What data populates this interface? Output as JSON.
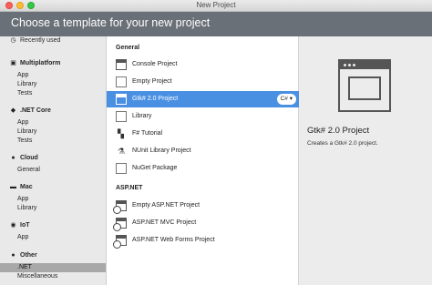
{
  "window": {
    "title": "New Project"
  },
  "header": {
    "title": "Choose a template for your new project"
  },
  "sidebar": {
    "recently_used": {
      "icon": "clock-icon",
      "label": "Recently used"
    },
    "categories": [
      {
        "name": "Multiplatform",
        "icon": "multiplatform-icon",
        "items": [
          "App",
          "Library",
          "Tests"
        ]
      },
      {
        "name": ".NET Core",
        "icon": "dotnet-core-icon",
        "items": [
          "App",
          "Library",
          "Tests"
        ]
      },
      {
        "name": "Cloud",
        "icon": "cloud-icon",
        "items": [
          "General"
        ]
      },
      {
        "name": "Mac",
        "icon": "mac-icon",
        "items": [
          "App",
          "Library"
        ]
      },
      {
        "name": "IoT",
        "icon": "iot-icon",
        "items": [
          "App"
        ]
      },
      {
        "name": "Other",
        "icon": "other-icon",
        "items": [
          ".NET",
          "Miscellaneous"
        ]
      }
    ],
    "selected_item": ".NET"
  },
  "templates": {
    "general_title": "General",
    "general": [
      {
        "label": "Console Project",
        "icon": "console-window-icon"
      },
      {
        "label": "Empty Project",
        "icon": "empty-project-icon"
      },
      {
        "label": "Gtk# 2.0 Project",
        "icon": "window-icon",
        "selected": true,
        "language": "C#"
      },
      {
        "label": "Library",
        "icon": "library-icon"
      },
      {
        "label": "F# Tutorial",
        "icon": "fsharp-icon"
      },
      {
        "label": "NUnit Library Project",
        "icon": "nunit-icon"
      },
      {
        "label": "NuGet Package",
        "icon": "nuget-icon"
      }
    ],
    "aspnet_title": "ASP.NET",
    "aspnet": [
      {
        "label": "Empty ASP.NET Project",
        "icon": "web-project-icon"
      },
      {
        "label": "ASP.NET MVC Project",
        "icon": "web-project-icon"
      },
      {
        "label": "ASP.NET Web Forms Project",
        "icon": "web-project-icon"
      }
    ]
  },
  "detail": {
    "title": "Gtk# 2.0 Project",
    "description": "Creates a Gtk# 2.0 project.",
    "preview_icon": "window-preview-icon"
  },
  "colors": {
    "header_bg": "#6a7077",
    "selection": "#4a90e2",
    "sidebar_selection": "#a8a8a8"
  }
}
